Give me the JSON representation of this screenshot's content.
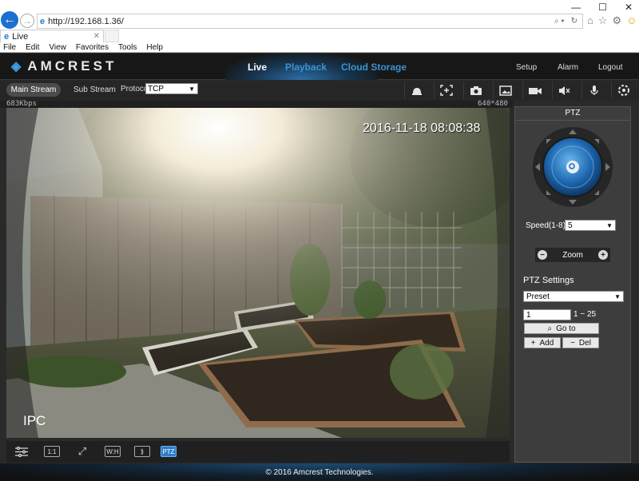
{
  "browser": {
    "url": "http://192.168.1.36/",
    "tab_title": "Live",
    "menu": [
      "File",
      "Edit",
      "View",
      "Favorites",
      "Tools",
      "Help"
    ]
  },
  "app": {
    "brand": "AMCREST",
    "nav": {
      "live": "Live",
      "playback": "Playback",
      "cloud": "Cloud Storage",
      "setup": "Setup",
      "alarm": "Alarm",
      "logout": "Logout"
    }
  },
  "toolbar": {
    "main_stream": "Main Stream",
    "sub_stream": "Sub Stream",
    "protocol_label": "Protocol",
    "protocol_value": "TCP",
    "icons": [
      "alarm-bell-icon",
      "region-focus-icon",
      "snapshot-camera-icon",
      "image-icon",
      "record-video-icon",
      "speaker-mute-icon",
      "microphone-icon",
      "fullscreen-icon"
    ]
  },
  "video": {
    "bitrate": "683Kbps",
    "resolution": "640*480",
    "timestamp": "2016-11-18 08:08:38",
    "channel_label": "IPC",
    "bar_icons": [
      "adjust",
      "1:1",
      "fit",
      "wh",
      "zoom",
      "PTZ"
    ]
  },
  "ptz": {
    "title": "PTZ",
    "speed_label": "Speed(1-8):",
    "speed_value": "5",
    "zoom_label": "Zoom",
    "settings_title": "PTZ Settings",
    "mode_value": "Preset",
    "preset_number": "1",
    "preset_range": "1 ~ 25",
    "goto_label": "Go to",
    "add_label": "Add",
    "del_label": "Del"
  },
  "footer": "© 2016 Amcrest Technologies."
}
